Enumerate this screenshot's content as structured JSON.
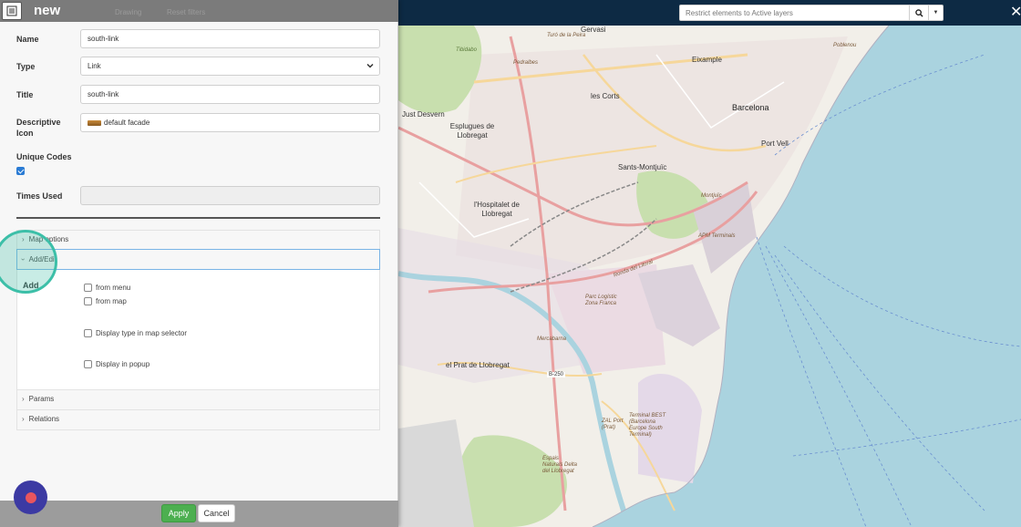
{
  "panel": {
    "title": "new",
    "header_ghost": [
      "Drawing",
      "Reset filters"
    ],
    "form": {
      "name_label": "Name",
      "name_value": "south-link",
      "type_label": "Type",
      "type_value": "Link",
      "title_label": "Title",
      "title_value": "south-link",
      "icon_label": "Descriptive Icon",
      "icon_value": "default facade",
      "unique_codes_label": "Unique Codes",
      "unique_codes_checked": true,
      "times_used_label": "Times Used",
      "times_used_value": ""
    },
    "sections": {
      "map_options": "Map options",
      "add_edit": "Add/Edit",
      "add_heading": "Add",
      "from_menu": "from menu",
      "from_map": "from map",
      "display_type": "Display type in map selector",
      "display_popup": "Display in popup",
      "params": "Params",
      "relations": "Relations"
    },
    "footer": {
      "apply": "Apply",
      "cancel": "Cancel"
    }
  },
  "map": {
    "search_placeholder": "Restrict elements to Active layers",
    "labels": {
      "gervasi": "Gervasi",
      "eixample": "Eixample",
      "les_corts": "les Corts",
      "barcelona": "Barcelona",
      "esplugues": "Esplugues de Llobregat",
      "just_desvern": "Just Desvern",
      "sants": "Sants-Montjuïc",
      "port_vell": "Port Vell",
      "hospitalet": "l'Hospitalet de Llobregat",
      "prat": "el Prat de Llobregat",
      "ronda": "Ronda del Litoral",
      "mercabarna": "Mercabarna",
      "parc_logistic": "Parc Logístic Zona Franca",
      "zal_port": "ZAL Port (Prat)",
      "terminal_best": "Terminal BEST (Barcelona Europe South Terminal)",
      "espais": "Espais Naturals Delta del Llobregat",
      "apm": "APM Terminals",
      "montjuic": "Montjuïc",
      "b250": "B-250",
      "turo": "Turó de la Peira",
      "tibidabo": "Tibidabo",
      "pedralbes": "Pedralbes",
      "poblenou": "Poblenou"
    },
    "colors": {
      "sea": "#aad3df",
      "land": "#f2efe9",
      "topbar": "#0d2a44",
      "road_major": "#e8a0a0",
      "road_secondary": "#f6d79a",
      "park": "#c8dfae"
    }
  }
}
